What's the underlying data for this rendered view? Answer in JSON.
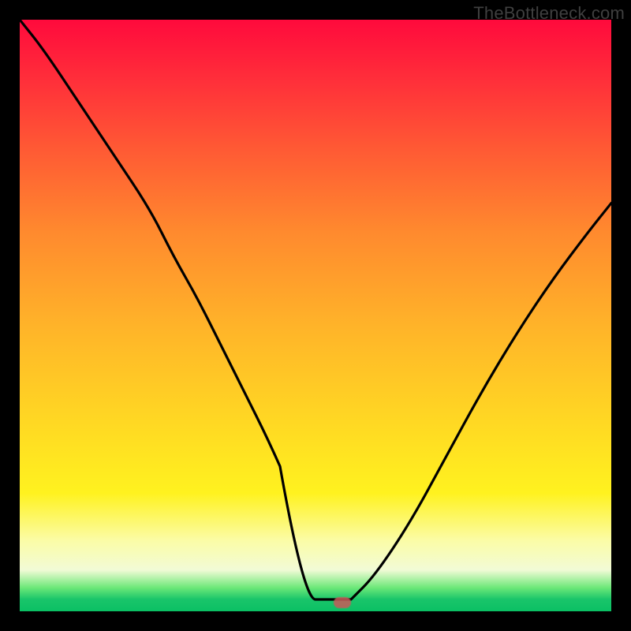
{
  "watermark": "TheBottleneck.com",
  "marker": {
    "x_frac": 0.545,
    "y_frac": 0.985,
    "color": "#c85a5a"
  },
  "chart_data": {
    "type": "line",
    "title": "",
    "xlabel": "",
    "ylabel": "",
    "xlim": [
      0,
      1
    ],
    "ylim": [
      0,
      1
    ],
    "grid": false,
    "series": [
      {
        "name": "bottleneck-curve",
        "x": [
          0.0,
          0.04,
          0.1,
          0.16,
          0.22,
          0.26,
          0.3,
          0.34,
          0.38,
          0.42,
          0.46,
          0.5,
          0.53,
          0.56,
          0.6,
          0.66,
          0.72,
          0.78,
          0.84,
          0.9,
          0.96,
          1.0
        ],
        "values": [
          1.0,
          0.95,
          0.86,
          0.77,
          0.68,
          0.6,
          0.53,
          0.45,
          0.37,
          0.29,
          0.2,
          0.11,
          0.04,
          0.02,
          0.06,
          0.15,
          0.26,
          0.37,
          0.47,
          0.56,
          0.64,
          0.69
        ]
      }
    ],
    "annotations": [
      {
        "text": "TheBottleneck.com",
        "pos": "top-right"
      }
    ],
    "flat_segment": {
      "x_start": 0.5,
      "x_end": 0.56,
      "y": 0.02
    },
    "gradient_stops": [
      {
        "pos": 0.0,
        "color": "#ff0a3c"
      },
      {
        "pos": 0.36,
        "color": "#ff8a2e"
      },
      {
        "pos": 0.68,
        "color": "#ffd823"
      },
      {
        "pos": 0.88,
        "color": "#fbfca6"
      },
      {
        "pos": 0.96,
        "color": "#6de879"
      },
      {
        "pos": 1.0,
        "color": "#0bc064"
      }
    ]
  }
}
